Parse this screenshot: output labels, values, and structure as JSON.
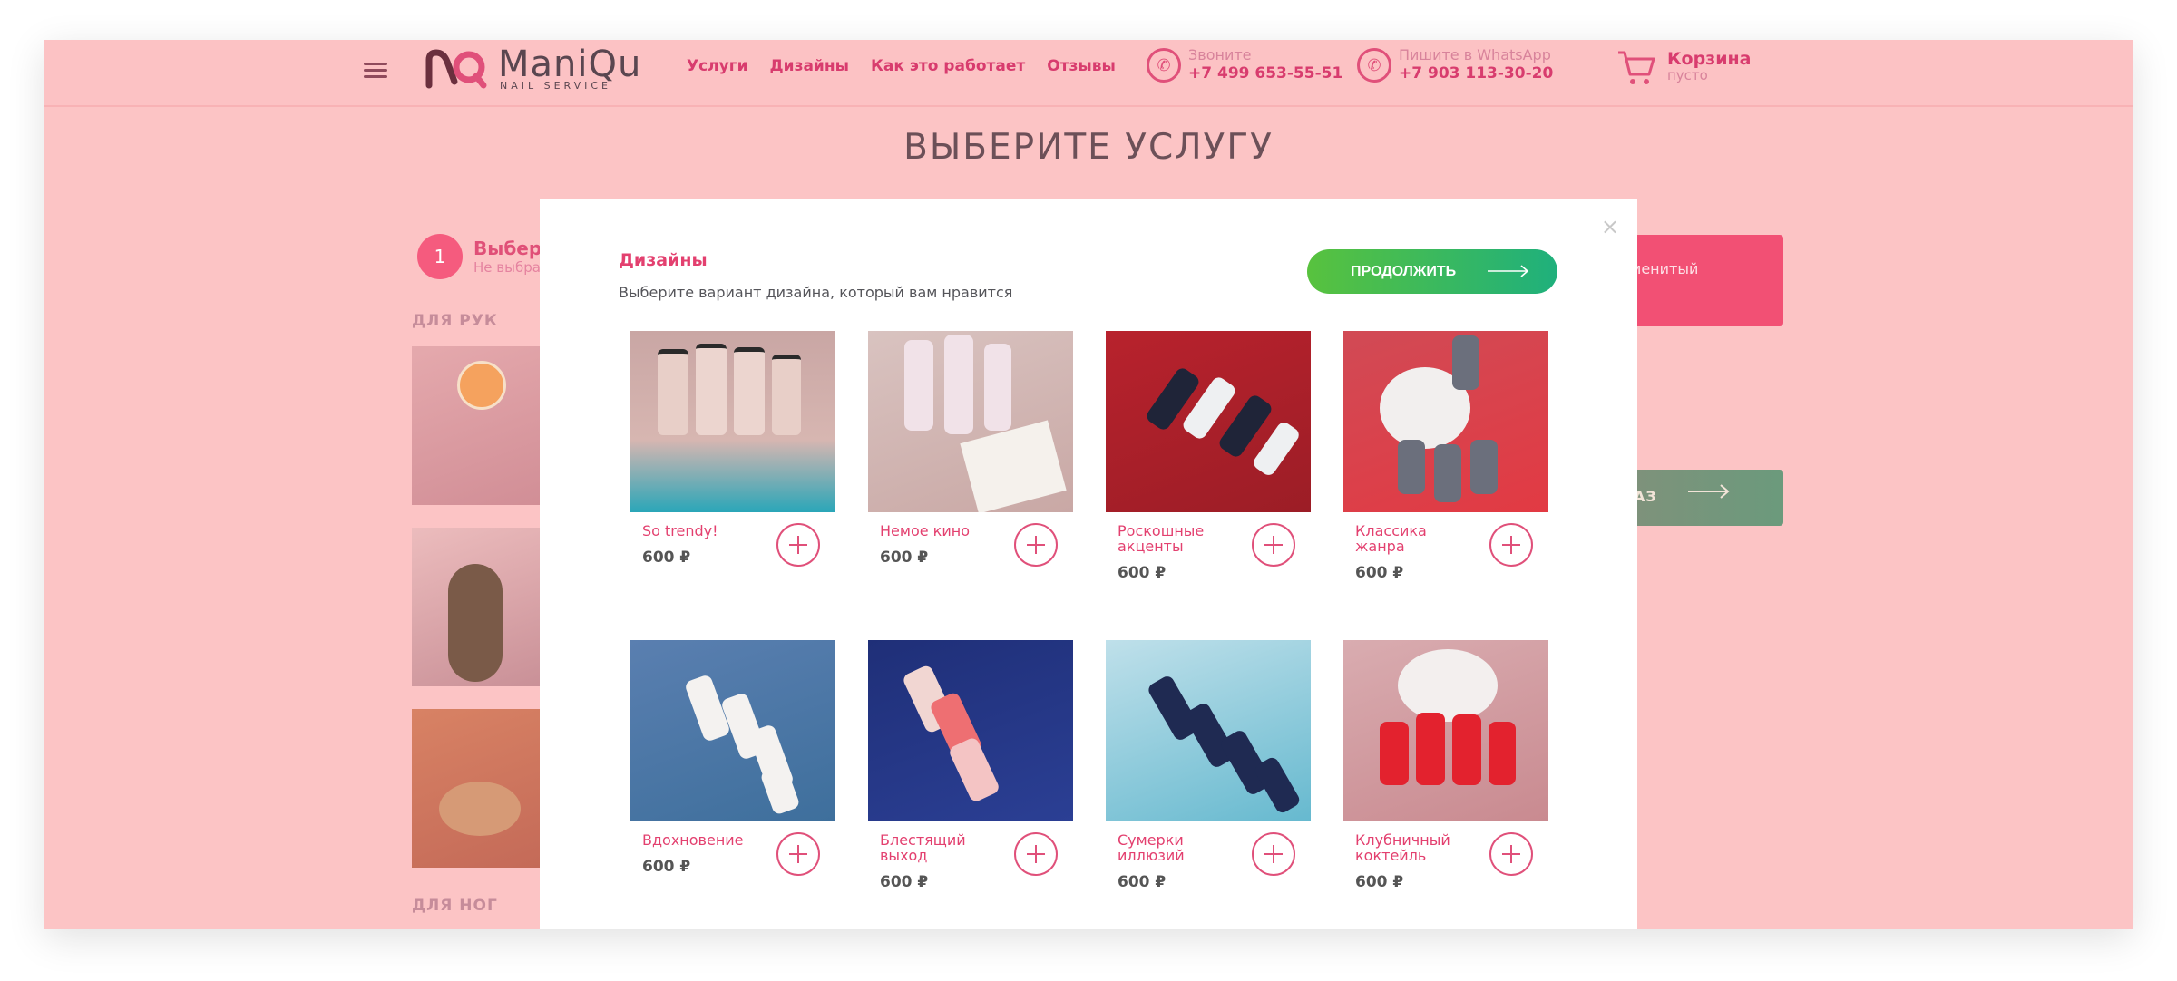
{
  "header": {
    "logo_text": "ManiQu",
    "logo_sub": "NAIL SERVICE",
    "nav": [
      "Услуги",
      "Дизайны",
      "Как это работает",
      "Отзывы"
    ],
    "phone": {
      "label": "Звоните",
      "number": "+7 499 653-55-51"
    },
    "whatsapp": {
      "label": "Пишите в WhatsApp",
      "number": "+7 903 113-30-20"
    },
    "cart": {
      "title": "Корзина",
      "status": "пусто"
    }
  },
  "page": {
    "title": "ВЫБЕРИТЕ УСЛУГУ",
    "step": {
      "number": "1",
      "title": "Выбери",
      "subtitle": "Не выбра"
    },
    "section_hands": "ДЛЯ РУК",
    "section_feet": "ДЛЯ НОГ",
    "right_card_text": "наменитый",
    "right_button_text": "АЗ"
  },
  "modal": {
    "title": "Дизайны",
    "subtitle": "Выберите вариант дизайна, который вам нравится",
    "continue_label": "ПРОДОЛЖИТЬ",
    "close_label": "×",
    "designs": [
      {
        "name": "So trendy!",
        "price": "600 ₽"
      },
      {
        "name": "Немое кино",
        "price": "600 ₽"
      },
      {
        "name": "Роскошные акценты",
        "price": "600 ₽"
      },
      {
        "name": "Классика жанра",
        "price": "600 ₽"
      },
      {
        "name": "Вдохновение",
        "price": "600 ₽"
      },
      {
        "name": "Блестящий выход",
        "price": "600 ₽"
      },
      {
        "name": "Сумерки иллюзий",
        "price": "600 ₽"
      },
      {
        "name": "Клубничный коктейль",
        "price": "600 ₽"
      }
    ]
  },
  "colors": {
    "accent": "#e3406f",
    "overlay_bg": "#fcc4c5",
    "continue_from": "#58c23e",
    "continue_to": "#1fb07c"
  }
}
